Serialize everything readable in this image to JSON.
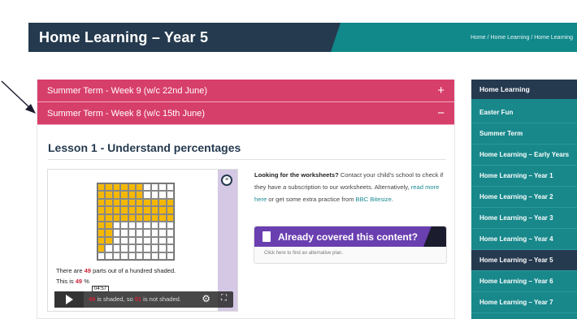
{
  "header": {
    "title": "Home Learning – Year 5",
    "breadcrumb": "Home / Home Learning / Home Learning"
  },
  "accordion": [
    {
      "label": "Summer Term - Week 9 (w/c 22nd June)",
      "toggle": "+"
    },
    {
      "label": "Summer Term - Week 8 (w/c 15th June)",
      "toggle": "−"
    }
  ],
  "lesson": {
    "title": "Lesson 1 - Understand percentages"
  },
  "video": {
    "bbc_icon": "bbc-bitesize-logo",
    "line1_a": "There are",
    "line1_val": "49",
    "line1_b": "parts out of a hundred shaded.",
    "line2_a": "This is",
    "line2_val": "49",
    "line2_b": "%",
    "line3_val": "49",
    "line3_a": "is shaded, so",
    "line3_val2": "51",
    "line3_b": "is not shaded.",
    "time": "04:57",
    "shaded_fraction": 0.49
  },
  "info": {
    "bold": "Looking for the worksheets?",
    "text1": " Contact your child's school to check if they have a subscription to our worksheets. Alternatively, ",
    "link1": "read more here",
    "text2": " or get some extra practice from ",
    "link2": "BBC Bitesize",
    "text3": "."
  },
  "covered": {
    "label": "Already covered this content?",
    "sub": "Click here to find an alternative plan."
  },
  "sidebar": {
    "heading": "Home Learning",
    "items": [
      {
        "label": "Easter Fun"
      },
      {
        "label": "Summer Term"
      },
      {
        "label": "Home Learning – Early Years"
      },
      {
        "label": "Home Learning – Year 1"
      },
      {
        "label": "Home Learning – Year 2"
      },
      {
        "label": "Home Learning – Year 3"
      },
      {
        "label": "Home Learning – Year 4"
      },
      {
        "label": "Home Learning – Year 5"
      },
      {
        "label": "Home Learning – Year 6"
      },
      {
        "label": "Home Learning – Year 7"
      }
    ],
    "active_index": 7
  },
  "colors": {
    "accordion": "#d73f6b",
    "navy": "#253a4f",
    "teal": "#11888a",
    "purple": "#6a3fb0",
    "shade": "#f5b800"
  }
}
